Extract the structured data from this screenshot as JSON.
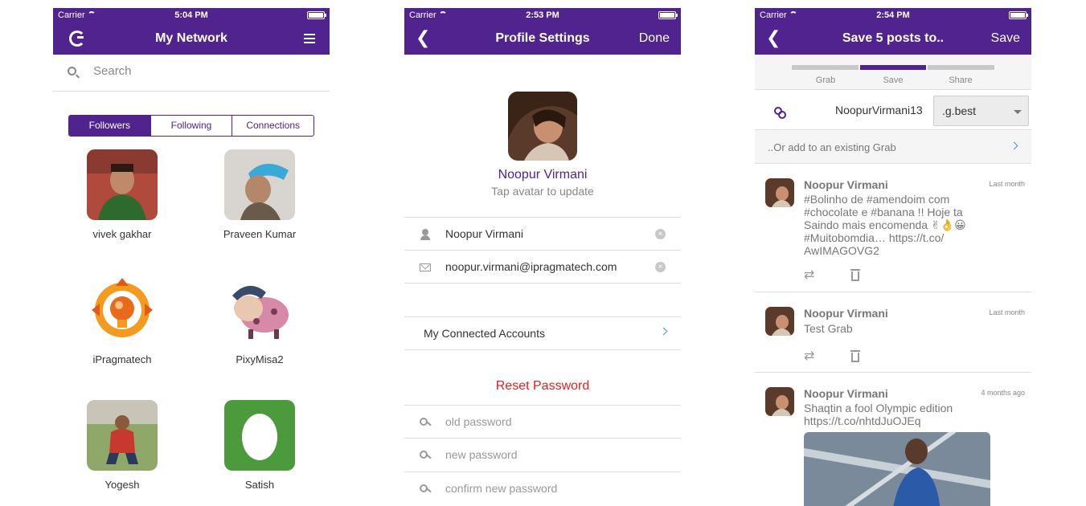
{
  "colors": {
    "brand": "#51238f",
    "danger": "#e02020",
    "link": "#4a90e2"
  },
  "phone1": {
    "status": {
      "carrier": "Carrier",
      "time": "5:04 PM"
    },
    "nav": {
      "title": "My Network",
      "left_icon": "app-logo-icon",
      "right_icon": "menu-icon"
    },
    "search": {
      "placeholder": "Search"
    },
    "tabs": [
      {
        "label": "Followers",
        "active": true
      },
      {
        "label": "Following",
        "active": false
      },
      {
        "label": "Connections",
        "active": false
      }
    ],
    "contacts": [
      {
        "name": "vivek gakhar"
      },
      {
        "name": "Praveen Kumar"
      },
      {
        "name": "iPragmatech"
      },
      {
        "name": "PixyMisa2"
      },
      {
        "name": "Yogesh"
      },
      {
        "name": "Satish"
      }
    ]
  },
  "phone2": {
    "status": {
      "carrier": "Carrier",
      "time": "2:53 PM"
    },
    "nav": {
      "title": "Profile Settings",
      "back_icon": "back-chevron-icon",
      "right": "Done"
    },
    "profile": {
      "name": "Noopur Virmani",
      "hint": "Tap avatar to update"
    },
    "fields": {
      "name": "Noopur Virmani",
      "email": "noopur.virmani@ipragmatech.com"
    },
    "connected_accounts": "My Connected Accounts",
    "reset": {
      "title": "Reset Password",
      "old": "old password",
      "new": "new password",
      "confirm": "confirm new password"
    }
  },
  "phone3": {
    "status": {
      "carrier": "Carrier",
      "time": "2:54 PM"
    },
    "nav": {
      "title": "Save 5 posts to..",
      "back_icon": "back-chevron-icon",
      "right": "Save"
    },
    "steps": [
      {
        "label": "Grab",
        "active": false
      },
      {
        "label": "Save",
        "active": true
      },
      {
        "label": "Share",
        "active": false
      }
    ],
    "grab": {
      "username": "NoopurVirmani13",
      "suffix": ".g.best"
    },
    "existing": "..Or add to an existing Grab",
    "posts": [
      {
        "author": "Noopur Virmani",
        "time": "Last month",
        "lines": [
          "#Bolinho de #amendoim com",
          "#chocolate e #banana !! Hoje ta",
          "Saindo mais encomenda ✌👌😀",
          "#Muitobomdia… https://t.co/",
          "AwIMAGOVG2"
        ]
      },
      {
        "author": "Noopur Virmani",
        "time": "Last month",
        "lines": [
          "Test Grab"
        ]
      },
      {
        "author": "Noopur Virmani",
        "time": "4 months ago",
        "lines": [
          "Shaqtin a fool Olympic edition",
          "https://t.co/nhtdJuOJEq"
        ]
      }
    ]
  }
}
